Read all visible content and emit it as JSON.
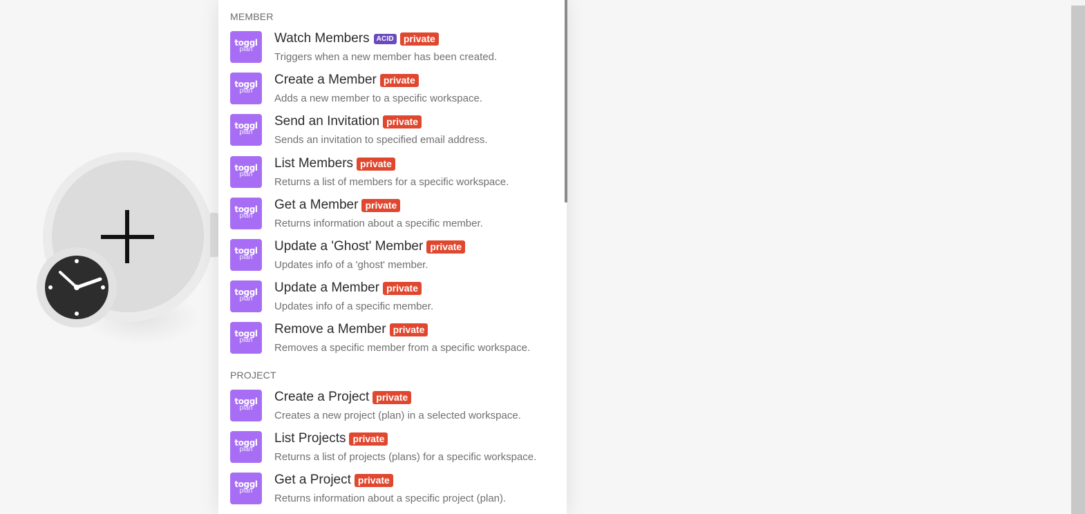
{
  "module": {
    "add_icon": "plus-icon",
    "trigger_icon": "clock-icon"
  },
  "app_icon": {
    "brand": "toggl",
    "sub": "plan",
    "color": "#a76df4"
  },
  "sections": [
    {
      "title": "MEMBER",
      "items": [
        {
          "title": "Watch Members",
          "acid": "ACID",
          "badge": "private",
          "desc": "Triggers when a new member has been created."
        },
        {
          "title": "Create a Member",
          "badge": "private",
          "desc": "Adds a new member to a specific workspace."
        },
        {
          "title": "Send an Invitation",
          "badge": "private",
          "desc": "Sends an invitation to specified email address."
        },
        {
          "title": "List Members",
          "badge": "private",
          "desc": "Returns a list of members for a specific workspace."
        },
        {
          "title": "Get a Member",
          "badge": "private",
          "desc": "Returns information about a specific member."
        },
        {
          "title": "Update a 'Ghost' Member",
          "badge": "private",
          "desc": "Updates info of a 'ghost' member."
        },
        {
          "title": "Update a Member",
          "badge": "private",
          "desc": "Updates info of a specific member."
        },
        {
          "title": "Remove a Member",
          "badge": "private",
          "desc": "Removes a specific member from a specific workspace."
        }
      ]
    },
    {
      "title": "PROJECT",
      "items": [
        {
          "title": "Create a Project",
          "badge": "private",
          "desc": "Creates a new project (plan) in a selected workspace."
        },
        {
          "title": "List Projects",
          "badge": "private",
          "desc": "Returns a list of projects (plans) for a specific workspace."
        },
        {
          "title": "Get a Project",
          "badge": "private",
          "desc": "Returns information about a specific project (plan)."
        }
      ]
    }
  ],
  "colors": {
    "private_badge": "#e0472f",
    "acid_badge": "#6a4bbd"
  }
}
